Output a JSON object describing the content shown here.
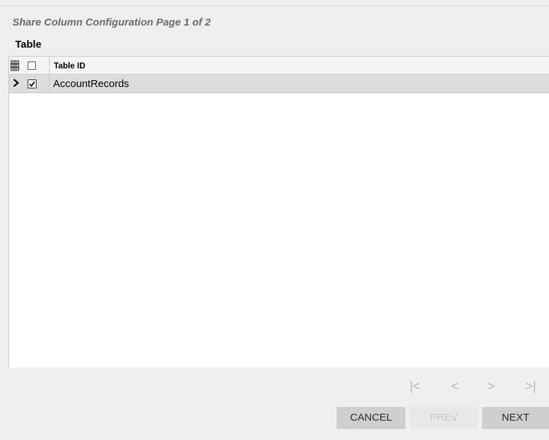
{
  "dialog": {
    "title": "Share Column Configuration Page 1 of 2",
    "section": "Table"
  },
  "grid": {
    "header": {
      "column_label": "Table ID",
      "select_all_checked": false
    },
    "rows": [
      {
        "table_id": "AccountRecords",
        "checked": true,
        "expanded": false
      }
    ]
  },
  "pager": {
    "first": "|<",
    "prev": "<",
    "next": ">",
    "last": ">|"
  },
  "buttons": {
    "cancel": "CANCEL",
    "prev": "PREV",
    "next": "NEXT"
  },
  "icons": {
    "grid_settings": "grid-settings-icon",
    "expander": "chevron-right-icon",
    "check": "checkmark-icon"
  }
}
